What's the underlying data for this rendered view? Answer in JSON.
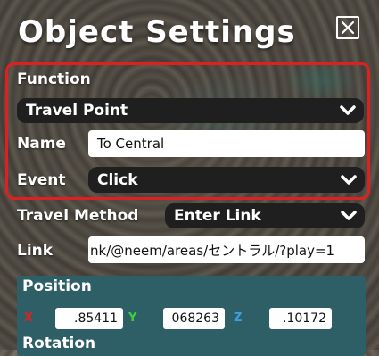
{
  "window": {
    "title": "Object Settings"
  },
  "function": {
    "label": "Function",
    "value": "Travel Point"
  },
  "name": {
    "label": "Name",
    "value": "To Central"
  },
  "event": {
    "label": "Event",
    "value": "Click"
  },
  "travel_method": {
    "label": "Travel Method",
    "value": "Enter Link"
  },
  "link": {
    "label": "Link",
    "value": "nk/@neem/areas/セントラル/?play=1"
  },
  "position": {
    "title": "Position",
    "x": {
      "axis": "X",
      "value": ".85411",
      "color": "#e02020"
    },
    "y": {
      "axis": "Y",
      "value": "068263",
      "color": "#3ad13a"
    },
    "z": {
      "axis": "Z",
      "value": ".10172",
      "color": "#3aa0e0"
    }
  },
  "rotation": {
    "title": "Rotation"
  },
  "colors": {
    "highlight": "#e02020",
    "section_bg": "#2f5f66",
    "dropdown_bg": "#1f1f1f"
  }
}
